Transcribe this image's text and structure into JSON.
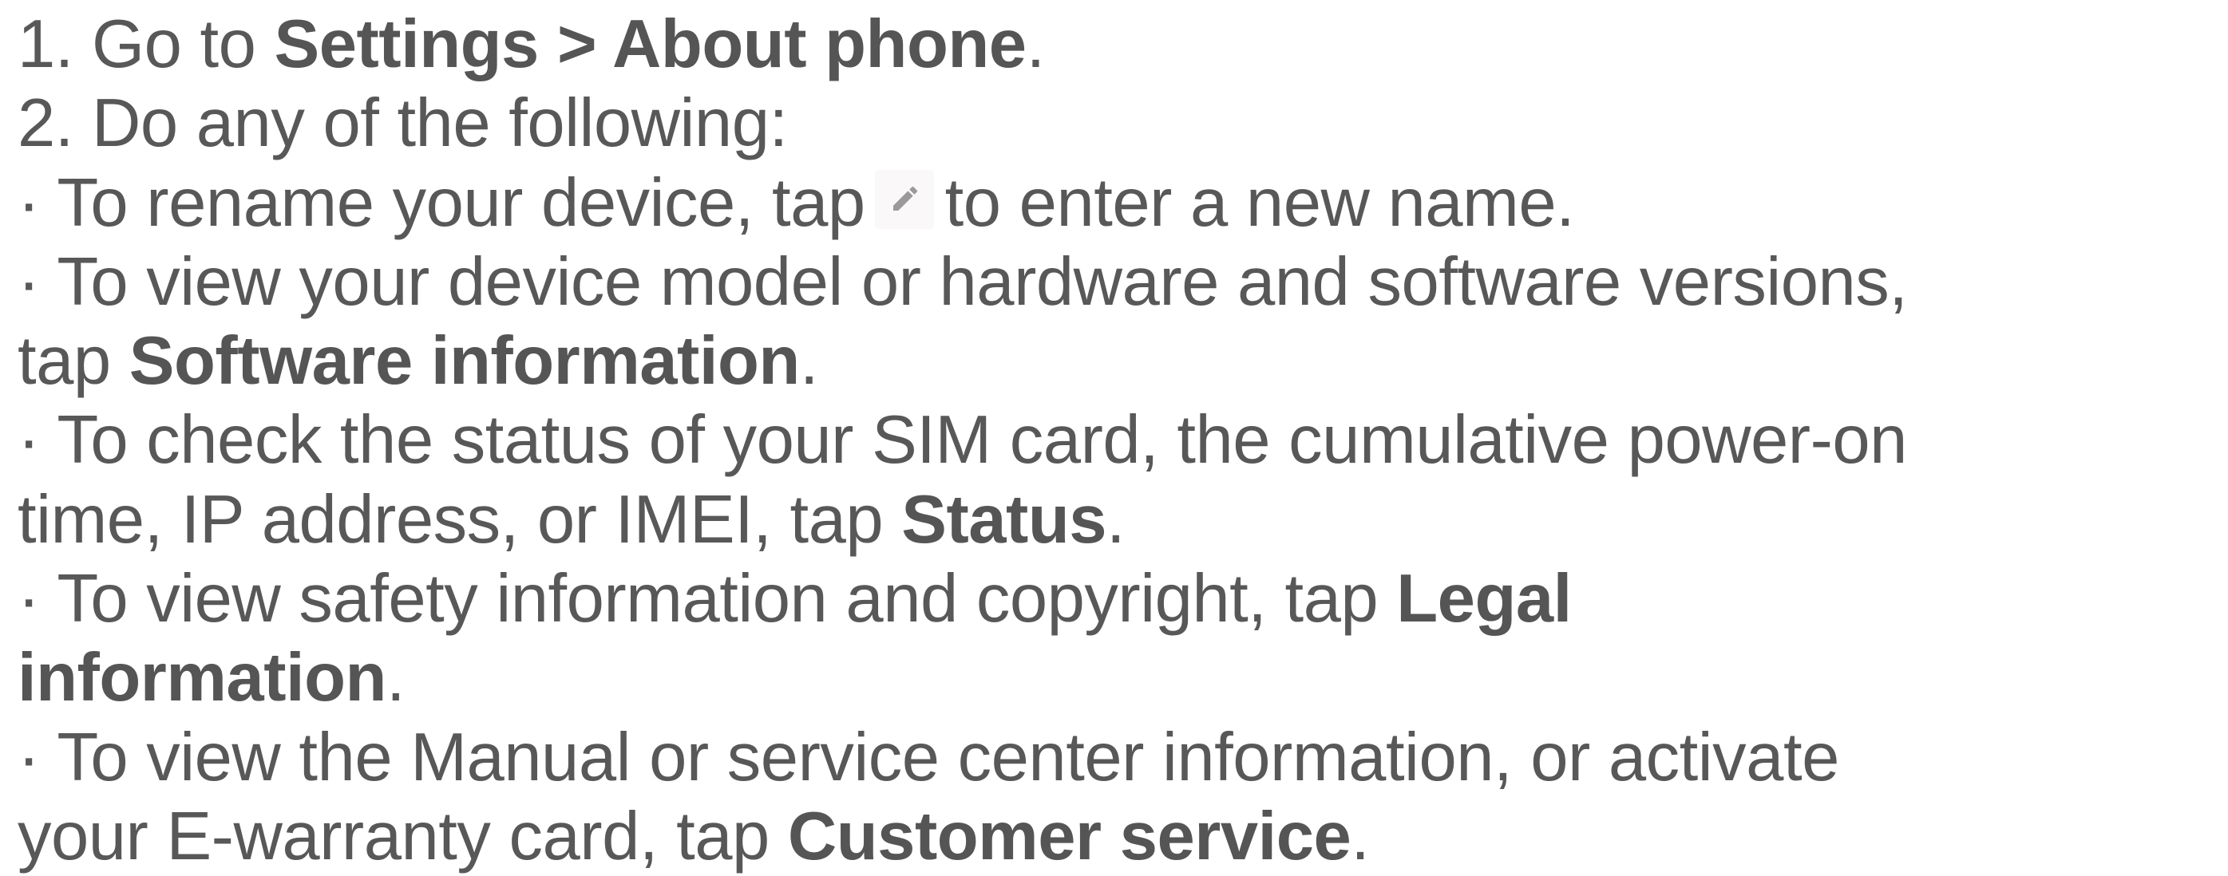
{
  "step1": {
    "prefix": "1. Go to ",
    "path": "Settings > About phone",
    "suffix": "."
  },
  "step2": {
    "text": "2. Do any of the following:"
  },
  "rename": {
    "before": "· To rename your device, tap",
    "icon": "pencil-edit-icon",
    "after": "to enter a new name."
  },
  "software": {
    "line1": "· To view your device model or hardware and software versions,",
    "prefix": "tap ",
    "bold": "Software information",
    "suffix": "."
  },
  "status": {
    "line1": "· To check the status of your SIM card, the cumulative power-on",
    "prefix": "time, IP address, or IMEI, tap ",
    "bold": "Status",
    "suffix": "."
  },
  "legal": {
    "prefix": "· To view safety information and copyright, tap ",
    "bold1": "Legal",
    "bold2": "information",
    "suffix": "."
  },
  "customer": {
    "line1": "· To view the Manual or service center information, or activate",
    "prefix": "your E-warranty card, tap ",
    "bold": "Customer service",
    "suffix": "."
  },
  "colors": {
    "text": "#585858",
    "icon_bg": "#fbf8fa",
    "icon": "#9a9a9a"
  }
}
